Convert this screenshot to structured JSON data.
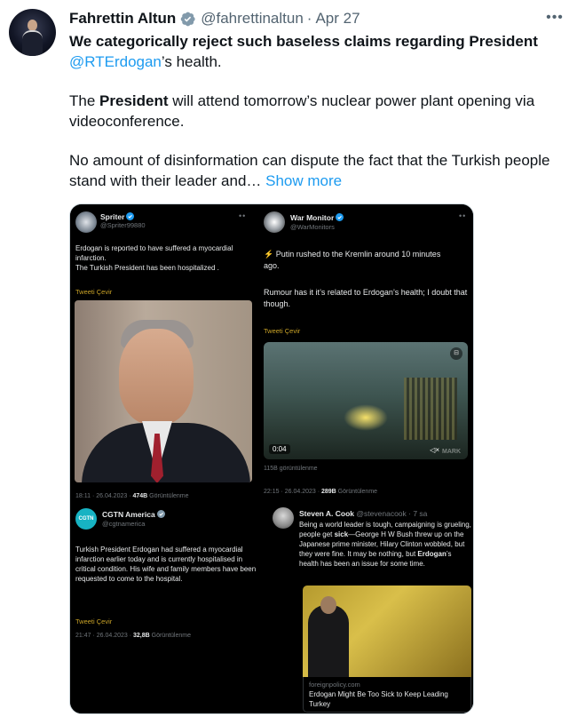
{
  "tweet": {
    "author_name": "Fahrettin Altun",
    "handle": "@fahrettinaltun",
    "separator": "·",
    "date": "Apr 27",
    "more_icon": "•••",
    "line1_bold": "We categorically reject such baseless claims regarding President",
    "mention": "@RTErdogan",
    "line1_rest": "’s health.",
    "p2_pre": "The ",
    "p2_bold": "President",
    "p2_rest": " will attend tomorrow’s nuclear power plant opening via videoconference.",
    "p3_text": "No amount of disinformation can dispute the fact that the Turkish people stand with their leader and… ",
    "show_more": "Show more"
  },
  "embedded": {
    "spriter": {
      "name": "Spriter",
      "handle": "@Spriter99880",
      "text1": "Erdogan is reported to have suffered a myocardial infarction.",
      "text2": "The Turkish President has been hospitalized .",
      "translate": "Tweeti Çevir",
      "meta_time": "18:11 · 26.04.2023 · ",
      "meta_views": "474B",
      "meta_label": " Görüntülenme"
    },
    "warmonitor": {
      "name": "War Monitor",
      "handle": "@WarMonitors",
      "text1": "⚡ Putin rushed to the Kremlin around 10 minutes ago.",
      "text2": "Rumour has it it’s related to Erdogan’s health; I doubt that though.",
      "translate": "Tweeti Çevir",
      "video_time": "0:04",
      "watermark": "MARK",
      "views_text": "115B görüntülenme",
      "meta_time": "22:15 · 26.04.2023 · ",
      "meta_views": "289B",
      "meta_label": " Görüntülenme"
    },
    "cgtn": {
      "avatar_text": "CGTN",
      "name": "CGTN America",
      "handle": "@cgtnamerica",
      "text": "Turkish President Erdogan had suffered a myocardial infarction earlier today and is currently hospitalised in critical condition. His wife and family members have been requested to come to the hospital.",
      "translate": "Tweeti Çevir",
      "meta_time": "21:47 · 26.04.2023 · ",
      "meta_views": "32,8B",
      "meta_label": " Görüntülenme"
    },
    "cook": {
      "name": "Steven A. Cook",
      "handle": "@stevenacook · 7 sa",
      "text_a": "Being a world leader is tough, campaigning is grueling, people get ",
      "text_sick": "sick",
      "text_b": "—George H W Bush threw up on the Japanese prime minister, Hilary Clinton wobbled, but they were fine. It may be nothing, but ",
      "text_erdogan": "Erdogan",
      "text_c": "’s health has been an issue for some time.",
      "news_source": "foreignpolicy.com",
      "news_title": "Erdogan Might Be Too Sick to Keep Leading Turkey"
    }
  },
  "colors": {
    "link": "#1d9bf0",
    "verified": "#1d9bf0",
    "translate": "#c9a227"
  }
}
